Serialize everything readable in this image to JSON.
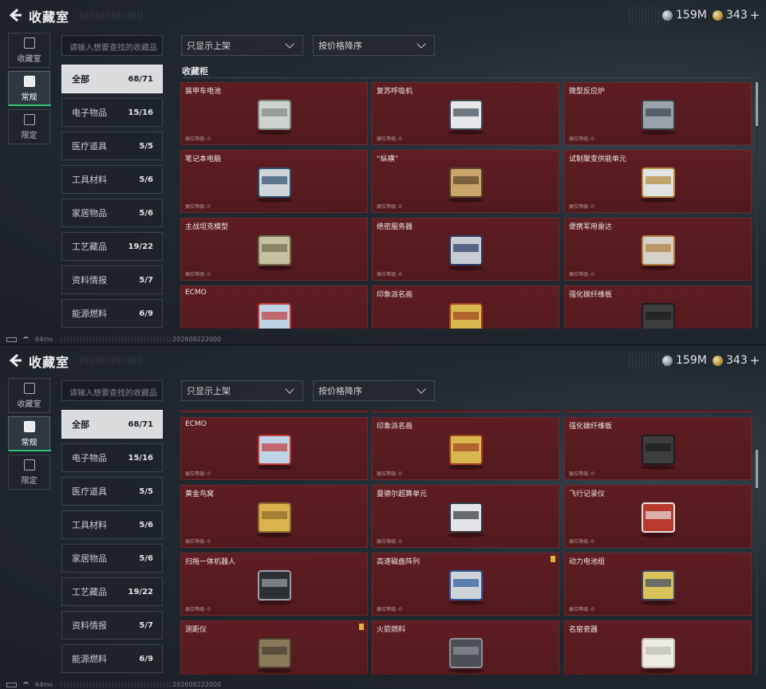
{
  "header": {
    "title": "收藏室",
    "currency_silver": "159M",
    "currency_gold": "343",
    "add_symbol": "+"
  },
  "rail": [
    {
      "label": "收藏室",
      "icon": "collection-room-icon"
    },
    {
      "label": "常规",
      "icon": "regular-icon",
      "active": true
    },
    {
      "label": "限定",
      "icon": "limited-icon"
    }
  ],
  "search": {
    "placeholder": "请输入想要查找的收藏品"
  },
  "filters": {
    "listing": "只显示上架",
    "sort": "按价格降序"
  },
  "categories": [
    {
      "label": "全部",
      "count": "68/71",
      "active": true
    },
    {
      "label": "电子物品",
      "count": "15/16"
    },
    {
      "label": "医疗道具",
      "count": "5/5"
    },
    {
      "label": "工具材料",
      "count": "5/6"
    },
    {
      "label": "家居物品",
      "count": "5/6"
    },
    {
      "label": "工艺藏品",
      "count": "19/22"
    },
    {
      "label": "资料情报",
      "count": "5/7"
    },
    {
      "label": "能源燃料",
      "count": "6/9"
    }
  ],
  "section_title": "收藏柜",
  "level_label": "展位等级: 0",
  "items": [
    {
      "name": "装甲车电池",
      "icon": "armored-vehicle-battery-icon",
      "colors": [
        "#cfd3cf",
        "#7f867f"
      ]
    },
    {
      "name": "复苏呼吸机",
      "icon": "resuscitation-ventilator-icon",
      "colors": [
        "#e5e7ea",
        "#3d4853"
      ]
    },
    {
      "name": "微型反应炉",
      "icon": "micro-reactor-icon",
      "colors": [
        "#9aa3ab",
        "#3b434a"
      ]
    },
    {
      "name": "笔记本电脑",
      "icon": "laptop-icon",
      "colors": [
        "#d0d5da",
        "#2b4d6b"
      ]
    },
    {
      "name": "“纵横”",
      "icon": "chessboard-icon",
      "colors": [
        "#c9a56a",
        "#5a4428"
      ]
    },
    {
      "name": "试制聚变供能单元",
      "icon": "fusion-power-unit-icon",
      "colors": [
        "#e0e2e4",
        "#b88a3a"
      ]
    },
    {
      "name": "主战坦克模型",
      "icon": "tank-model-icon",
      "colors": [
        "#c8c1a0",
        "#6e694d"
      ]
    },
    {
      "name": "绝密服务器",
      "icon": "secret-server-icon",
      "colors": [
        "#c7ccd2",
        "#2a3a66"
      ]
    },
    {
      "name": "便携军用雷达",
      "icon": "portable-radar-icon",
      "colors": [
        "#d4d2c8",
        "#b07a3a"
      ]
    },
    {
      "name": "ECMO",
      "icon": "ecmo-icon",
      "colors": [
        "#bfd3e6",
        "#c23a3a"
      ]
    },
    {
      "name": "印象派名画",
      "icon": "impressionist-painting-icon",
      "colors": [
        "#d9b64e",
        "#a0421f"
      ]
    },
    {
      "name": "强化碳纤维板",
      "icon": "carbon-fiber-plate-icon",
      "colors": [
        "#3e3e40",
        "#1c1c1e"
      ]
    },
    {
      "name": "黄金鸟窝",
      "icon": "golden-bird-nest-icon",
      "colors": [
        "#d9b34e",
        "#8a6a2a"
      ]
    },
    {
      "name": "曼德尔超算单元",
      "icon": "supercomputing-unit-icon",
      "colors": [
        "#e1e3e6",
        "#30363c"
      ],
      "marked": false
    },
    {
      "name": "飞行记录仪",
      "icon": "flight-recorder-icon",
      "colors": [
        "#b83a2e",
        "#e7e3e0"
      ]
    },
    {
      "name": "扫拖一体机器人",
      "icon": "mopping-robot-icon",
      "colors": [
        "#2c2f33",
        "#9aa0a6"
      ]
    },
    {
      "name": "高速磁盘阵列",
      "icon": "disk-array-icon",
      "colors": [
        "#cdd3d9",
        "#2a5a9a"
      ],
      "marked": true
    },
    {
      "name": "动力电池组",
      "icon": "power-battery-pack-icon",
      "colors": [
        "#d8c25a",
        "#3a4a6a"
      ]
    },
    {
      "name": "测距仪",
      "icon": "rangefinder-icon",
      "colors": [
        "#8a7a5a",
        "#4a4030"
      ],
      "marked": true
    },
    {
      "name": "火箭燃料",
      "icon": "rocket-fuel-icon",
      "colors": [
        "#4a5056",
        "#8c9298"
      ]
    },
    {
      "name": "名窑瓷器",
      "icon": "porcelain-vase-icon",
      "colors": [
        "#ecebe4",
        "#bdbcae"
      ]
    }
  ],
  "footer": {
    "ping": "64ms",
    "timestamp": "202608222000"
  }
}
